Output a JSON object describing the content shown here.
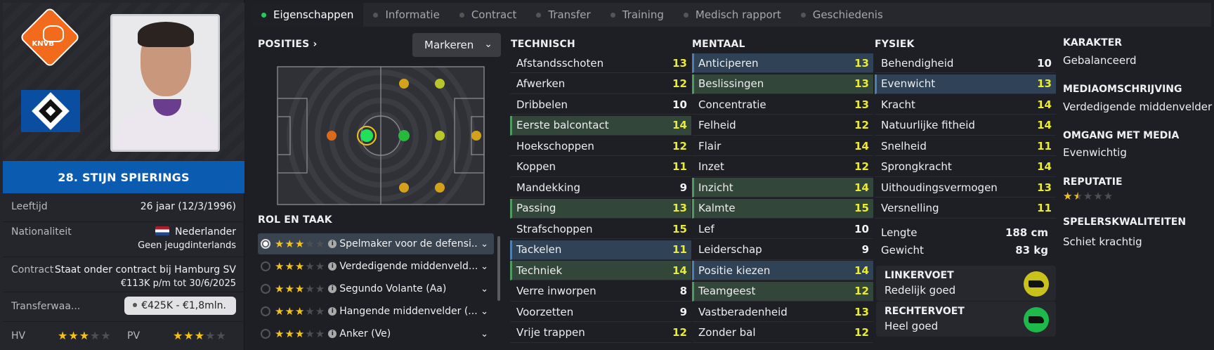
{
  "player": {
    "name": "28. STIJN SPIERINGS",
    "age_label": "Leeftijd",
    "age_value": "26 jaar  (12/3/1996)",
    "nationality_label": "Nationaliteit",
    "nationality": "Nederlander",
    "intl": "Geen jeugdinterlands",
    "contract_label": "Contract",
    "contract_line1": "Staat onder contract bij Hamburg SV",
    "contract_line2": "€113K p/m tot 30/6/2025",
    "transfer_label": "Transferwaa...",
    "transfer_value": "€425K - €1,8mln.",
    "hv_label": "HV",
    "hv_stars": 3,
    "pv_label": "PV",
    "pv_stars": 3,
    "badge_text": "KNVB"
  },
  "tabs": [
    {
      "label": "Eigenschappen",
      "active": true
    },
    {
      "label": "Informatie",
      "active": false
    },
    {
      "label": "Contract",
      "active": false
    },
    {
      "label": "Transfer",
      "active": false
    },
    {
      "label": "Training",
      "active": false
    },
    {
      "label": "Medisch rapport",
      "active": false
    },
    {
      "label": "Geschiedenis",
      "active": false
    }
  ],
  "positions": {
    "title": "POSITIES",
    "highlight_button": "Markeren"
  },
  "roles": {
    "title": "ROL EN TAAK",
    "items": [
      {
        "name": "Spelmaker voor de defensi...",
        "stars": 3,
        "selected": true
      },
      {
        "name": "Verdedigende middenveld...",
        "stars": 3,
        "selected": false
      },
      {
        "name": "Segundo Volante (Aa)",
        "stars": 3,
        "selected": false
      },
      {
        "name": "Hangende middenvelder (...",
        "stars": 3,
        "selected": false
      },
      {
        "name": "Anker (Ve)",
        "stars": 3,
        "selected": false
      }
    ]
  },
  "technisch": {
    "title": "TECHNISCH",
    "attrs": [
      {
        "name": "Afstandsschoten",
        "value": "13",
        "hl": "",
        "color": "y"
      },
      {
        "name": "Afwerken",
        "value": "12",
        "hl": "",
        "color": "y"
      },
      {
        "name": "Dribbelen",
        "value": "10",
        "hl": "",
        "color": "w"
      },
      {
        "name": "Eerste balcontact",
        "value": "14",
        "hl": "g",
        "color": "y"
      },
      {
        "name": "Hoekschoppen",
        "value": "12",
        "hl": "",
        "color": "y"
      },
      {
        "name": "Koppen",
        "value": "11",
        "hl": "",
        "color": "y"
      },
      {
        "name": "Mandekking",
        "value": "9",
        "hl": "",
        "color": "w"
      },
      {
        "name": "Passing",
        "value": "13",
        "hl": "g",
        "color": "y"
      },
      {
        "name": "Strafschoppen",
        "value": "15",
        "hl": "",
        "color": "y"
      },
      {
        "name": "Tackelen",
        "value": "11",
        "hl": "b",
        "color": "y"
      },
      {
        "name": "Techniek",
        "value": "14",
        "hl": "g",
        "color": "y"
      },
      {
        "name": "Verre inworpen",
        "value": "8",
        "hl": "",
        "color": "w"
      },
      {
        "name": "Voorzetten",
        "value": "9",
        "hl": "",
        "color": "w"
      },
      {
        "name": "Vrije trappen",
        "value": "12",
        "hl": "",
        "color": "y"
      }
    ]
  },
  "mentaal": {
    "title": "MENTAAL",
    "attrs": [
      {
        "name": "Anticiperen",
        "value": "13",
        "hl": "b",
        "color": "y"
      },
      {
        "name": "Beslissingen",
        "value": "13",
        "hl": "g",
        "color": "y"
      },
      {
        "name": "Concentratie",
        "value": "13",
        "hl": "",
        "color": "y"
      },
      {
        "name": "Felheid",
        "value": "12",
        "hl": "",
        "color": "y"
      },
      {
        "name": "Flair",
        "value": "14",
        "hl": "",
        "color": "y"
      },
      {
        "name": "Inzet",
        "value": "12",
        "hl": "",
        "color": "y"
      },
      {
        "name": "Inzicht",
        "value": "14",
        "hl": "g",
        "color": "y"
      },
      {
        "name": "Kalmte",
        "value": "15",
        "hl": "g",
        "color": "y"
      },
      {
        "name": "Lef",
        "value": "10",
        "hl": "",
        "color": "w"
      },
      {
        "name": "Leiderschap",
        "value": "9",
        "hl": "",
        "color": "w"
      },
      {
        "name": "Positie kiezen",
        "value": "14",
        "hl": "b",
        "color": "y"
      },
      {
        "name": "Teamgeest",
        "value": "12",
        "hl": "g",
        "color": "y"
      },
      {
        "name": "Vastberadenheid",
        "value": "13",
        "hl": "",
        "color": "y"
      },
      {
        "name": "Zonder bal",
        "value": "12",
        "hl": "",
        "color": "y"
      }
    ]
  },
  "fysiek": {
    "title": "FYSIEK",
    "attrs": [
      {
        "name": "Behendigheid",
        "value": "10",
        "hl": "",
        "color": "w"
      },
      {
        "name": "Evenwicht",
        "value": "13",
        "hl": "b",
        "color": "y"
      },
      {
        "name": "Kracht",
        "value": "14",
        "hl": "",
        "color": "y"
      },
      {
        "name": "Natuurlijke fitheid",
        "value": "14",
        "hl": "",
        "color": "y"
      },
      {
        "name": "Snelheid",
        "value": "11",
        "hl": "",
        "color": "y"
      },
      {
        "name": "Sprongkracht",
        "value": "14",
        "hl": "",
        "color": "y"
      },
      {
        "name": "Uithoudingsvermogen",
        "value": "13",
        "hl": "",
        "color": "y"
      },
      {
        "name": "Versnelling",
        "value": "11",
        "hl": "",
        "color": "y"
      }
    ],
    "height_label": "Lengte",
    "height_value": "188 cm",
    "weight_label": "Gewicht",
    "weight_value": "83 kg",
    "left_foot_label": "LINKERVOET",
    "left_foot_value": "Redelijk goed",
    "right_foot_label": "RECHTERVOET",
    "right_foot_value": "Heel goed"
  },
  "right": {
    "karakter_title": "KARAKTER",
    "karakter": "Gebalanceerd",
    "media_title": "MEDIAOMSCHRIJVING",
    "media": "Verdedigende middenvelder",
    "omgang_title": "OMGANG MET MEDIA",
    "omgang": "Evenwichtig",
    "reputatie_title": "REPUTATIE",
    "reputatie_stars": 1.5,
    "kwaliteiten_title": "SPELERSKWALITEITEN",
    "kwaliteiten": "Schiet krachtig"
  },
  "colors": {
    "accent_blue": "#0b5bb0",
    "star": "#f3c21a",
    "attr_yellow": "#eaeb33",
    "hl_green": "#33463a",
    "hl_blue": "#2f4256"
  }
}
